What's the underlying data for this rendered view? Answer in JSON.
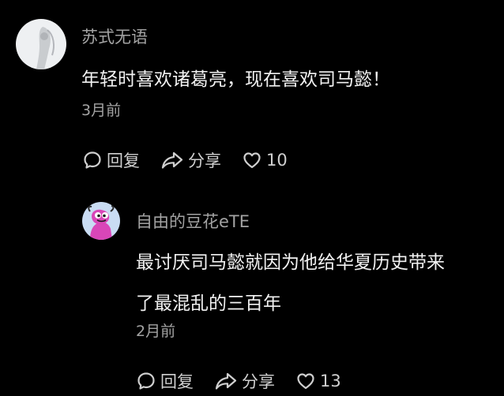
{
  "comment": {
    "username": "苏式无语",
    "text": "年轻时喜欢诸葛亮，现在喜欢司马懿！",
    "time": "3月前",
    "actions": {
      "reply_label": "回复",
      "share_label": "分享",
      "like_count": "10"
    }
  },
  "reply": {
    "username": "自由的豆花eTE",
    "text_line1": "最讨厌司马懿就因为他给华夏历史带来",
    "text_line2": "了最混乱的三百年",
    "time": "2月前",
    "actions": {
      "reply_label": "回复",
      "share_label": "分享",
      "like_count": "13"
    }
  },
  "icons": {
    "reply": "comment-bubble-icon",
    "share": "share-arrow-icon",
    "like": "heart-outline-icon"
  },
  "colors": {
    "background": "#000000",
    "meta_text": "#a3a3a3",
    "body_text": "#f2f2f2",
    "action_text": "#cfcfcf",
    "reply_avatar_bg": "#c9dcf3",
    "reply_avatar_character": "#d946b8"
  }
}
